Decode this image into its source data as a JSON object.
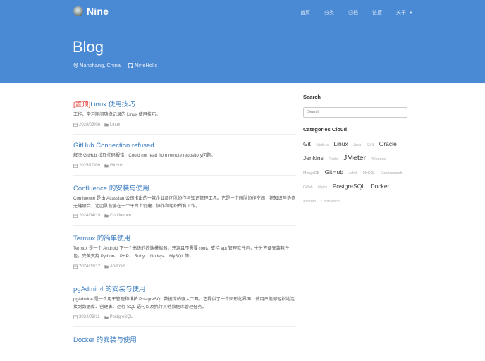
{
  "header": {
    "brand_name": "Nine",
    "nav": [
      {
        "label": "首页"
      },
      {
        "label": "分类"
      },
      {
        "label": "归档"
      },
      {
        "label": "链接"
      },
      {
        "label": "关于"
      }
    ],
    "site_title": "Blog",
    "location": "Nanchang, China",
    "github": "NineHolic",
    "colors": {
      "header_bg": "#4a89d3",
      "link": "#3a7bbf",
      "pin": "#e53935"
    }
  },
  "posts": [
    {
      "pin": "[置顶]",
      "title": "Linux 使用技巧",
      "desc": "工作、学习期间随缘记录的 Linux 使用技巧。",
      "date": "2020/03/08",
      "category": "Linux"
    },
    {
      "title": "GitHub Connection refused",
      "desc": "解决 GitHub 拉取代码报错：Could not read from remote repository问题。",
      "date": "2025/10/09",
      "category": "GitHub"
    },
    {
      "title": "Confluence 的安装与使用",
      "desc": "Confluence 是由 Atlassian 公司推出的一款企业级团队协作与知识管理工具。它是一个团队协作空间，将知识与协作无缝融合，让团队能够在一个平台上创建、协作和组织所有工作。",
      "date": "2024/04/19",
      "category": "Confluence"
    },
    {
      "title": "Termux 的简单使用",
      "desc": "Termux 是一个 Android 下一个高级的终端模拟器，开源且不需要 root，支持 apt 管理软件包，十分方便安装软件包，完美支持 Python、 PHP、 Ruby、 Nodejs、 MySQL 等。",
      "date": "2024/03/12",
      "category": "Android"
    },
    {
      "title": "pgAdmin4 的安装与使用",
      "desc": "pgAdmin4 是一个用于管理和维护 PostgreSQL 数据库的强大工具。它提供了一个图形化界面，使用户能够轻松地连接到数据库、创建表、运行 SQL 语句以及执行其他数据库管理任务。",
      "date": "2024/03/11",
      "category": "PostgreSQL"
    },
    {
      "title": "Docker 的安装与使用",
      "desc": "",
      "date": "",
      "category": ""
    }
  ],
  "sidebar": {
    "search_heading": "Search",
    "search_placeholder": "Search",
    "cloud_heading": "Categories Cloud",
    "tags": [
      {
        "name": "Git",
        "size": "l"
      },
      {
        "name": "Node.js",
        "size": "s"
      },
      {
        "name": "Linux",
        "size": "l"
      },
      {
        "name": "Java",
        "size": "s"
      },
      {
        "name": "SVN",
        "size": "s"
      },
      {
        "name": "Oracle",
        "size": "l"
      },
      {
        "name": "Jenkins",
        "size": "l"
      },
      {
        "name": "Redis",
        "size": "s"
      },
      {
        "name": "JMeter",
        "size": "xl"
      },
      {
        "name": "Windows",
        "size": "s"
      },
      {
        "name": "MongoDB",
        "size": "s"
      },
      {
        "name": "GitHub",
        "size": "l"
      },
      {
        "name": "Jekyll",
        "size": "s"
      },
      {
        "name": "MySQL",
        "size": "s"
      },
      {
        "name": "Elasticsearch",
        "size": "s"
      },
      {
        "name": "Gitlab",
        "size": "s"
      },
      {
        "name": "Nginx",
        "size": "s"
      },
      {
        "name": "PostgreSQL",
        "size": "l"
      },
      {
        "name": "Docker",
        "size": "l"
      },
      {
        "name": "Android",
        "size": "s"
      },
      {
        "name": "Confluence",
        "size": "s"
      }
    ]
  }
}
